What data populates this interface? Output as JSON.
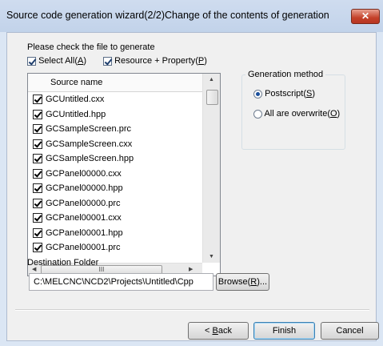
{
  "window": {
    "title": "Source code generation wizard(2/2)Change of the contents of generation",
    "close_glyph": "✕"
  },
  "instructions": "Please check the file to generate",
  "select_all": {
    "label": "Select All",
    "mnemonic": "A",
    "checked": true
  },
  "resource_property": {
    "label": "Resource + Property",
    "mnemonic": "P",
    "checked": true
  },
  "file_list": {
    "header": "Source name",
    "items": [
      {
        "name": "GCUntitled.cxx",
        "checked": true
      },
      {
        "name": "GCUntitled.hpp",
        "checked": true
      },
      {
        "name": "GCSampleScreen.prc",
        "checked": true
      },
      {
        "name": "GCSampleScreen.cxx",
        "checked": true
      },
      {
        "name": "GCSampleScreen.hpp",
        "checked": true
      },
      {
        "name": "GCPanel00000.cxx",
        "checked": true
      },
      {
        "name": "GCPanel00000.hpp",
        "checked": true
      },
      {
        "name": "GCPanel00000.prc",
        "checked": true
      },
      {
        "name": "GCPanel00001.cxx",
        "checked": true
      },
      {
        "name": "GCPanel00001.hpp",
        "checked": true
      },
      {
        "name": "GCPanel00001.prc",
        "checked": true
      }
    ],
    "hscroll_thumb_grip": "III"
  },
  "generation_method": {
    "title": "Generation method",
    "options": [
      {
        "label": "Postscript",
        "mnemonic": "S",
        "selected": true
      },
      {
        "label": "All are overwrite",
        "mnemonic": "O",
        "selected": false
      }
    ]
  },
  "destination": {
    "label": "Destination Folder",
    "path": "C:\\MELCNC\\NCD2\\Projects\\Untitled\\Cpp",
    "browse_label": "Browse(",
    "browse_mnemonic": "R",
    "browse_suffix": ")..."
  },
  "buttons": {
    "back_prefix": "< ",
    "back_mnemonic": "B",
    "back_rest": "ack",
    "finish": "Finish",
    "cancel": "Cancel"
  },
  "colors": {
    "title_bar": "#c7d7ed",
    "close_button": "#c4412a",
    "dialog_bg": "#f0f0f0"
  }
}
